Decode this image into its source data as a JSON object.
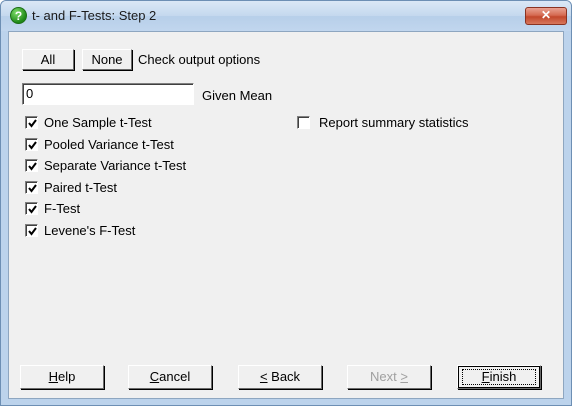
{
  "window": {
    "title": "t- and F-Tests: Step 2",
    "close_symbol": "✕",
    "help_icon_glyph": "?"
  },
  "output_options": {
    "all_label": "All",
    "none_label": "None",
    "caption": "Check output options"
  },
  "given_mean": {
    "value": "0",
    "label": "Given Mean"
  },
  "tests": [
    {
      "label": "One Sample t-Test",
      "checked": true
    },
    {
      "label": "Pooled Variance t-Test",
      "checked": true
    },
    {
      "label": "Separate Variance t-Test",
      "checked": true
    },
    {
      "label": "Paired t-Test",
      "checked": true
    },
    {
      "label": "F-Test",
      "checked": true
    },
    {
      "label": "Levene's F-Test",
      "checked": true
    }
  ],
  "report_summary": {
    "label": "Report summary statistics",
    "checked": false
  },
  "footer": {
    "help": {
      "mnemonic": "H",
      "rest": "elp"
    },
    "cancel": {
      "mnemonic": "C",
      "rest": "ancel"
    },
    "back": {
      "mnemonic": "<",
      "rest": " Back"
    },
    "next": {
      "prefix": "Next ",
      "mnemonic": ">",
      "enabled": false
    },
    "finish": {
      "mnemonic": "F",
      "rest": "inish"
    }
  },
  "colors": {
    "dialog_bg": "#f0f0f0",
    "frame": "#bcd3ec",
    "disabled_text": "#a0a0a0"
  }
}
